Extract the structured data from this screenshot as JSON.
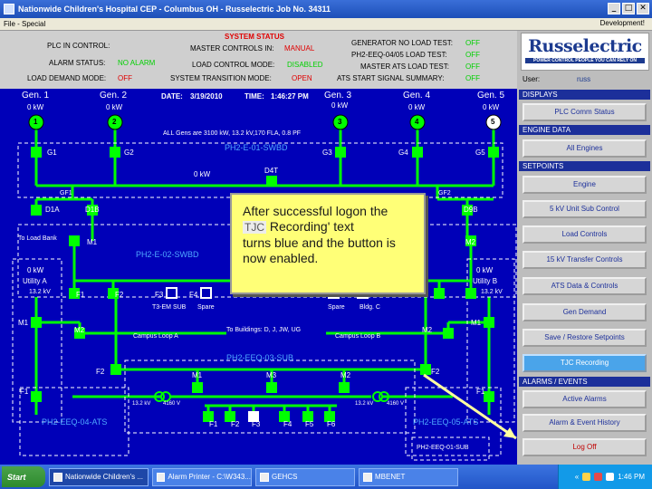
{
  "window": {
    "title": "Nationwide Children's Hospital CEP - Columbus OH - Russelectric Job No. 34311",
    "minimize": "_",
    "maximize": "□",
    "close": "✕"
  },
  "menu": {
    "file_special": "File - Special",
    "development": "Development!"
  },
  "status": {
    "title": "SYSTEM STATUS",
    "plc_label": "PLC IN CONTROL:",
    "alarm_label": "ALARM STATUS:",
    "alarm_value": "NO ALARM",
    "load_demand_label": "LOAD DEMAND MODE:",
    "load_demand_value": "OFF",
    "master_controls_label": "MASTER CONTROLS IN:",
    "master_controls_value": "MANUAL",
    "load_control_label": "LOAD CONTROL MODE:",
    "load_control_value": "DISABLED",
    "transition_label": "SYSTEM TRANSITION MODE:",
    "transition_value": "OPEN",
    "gen_no_load_label": "GENERATOR NO LOAD TEST:",
    "gen_no_load_value": "OFF",
    "ph2_load_label": "PH2-EEQ-04/05 LOAD TEST:",
    "ph2_load_value": "OFF",
    "master_ats_label": "MASTER ATS LOAD TEST:",
    "master_ats_value": "OFF",
    "ats_summary_label": "ATS START SIGNAL SUMMARY:",
    "ats_summary_value": "OFF"
  },
  "diagram": {
    "gens": [
      {
        "name": "Gen. 1",
        "kw": "0 kW",
        "num": "1"
      },
      {
        "name": "Gen. 2",
        "kw": "0 kW",
        "num": "2"
      },
      {
        "name": "Gen. 3",
        "kw": "0 kW",
        "num": "3"
      },
      {
        "name": "Gen. 4",
        "kw": "0 kW",
        "num": "4"
      },
      {
        "name": "Gen. 5",
        "kw": "0 kW",
        "num": "5"
      }
    ],
    "date_label": "DATE:",
    "date_value": "3/19/2010",
    "time_label": "TIME:",
    "time_value": "1:46:27 PM",
    "rating_note": "ALL Gens are 3100 kW, 13.2 kV,170 FLA, 0.8 PF",
    "swbd1": "PH2-E-01-SWBD",
    "swbd1_kw": "0 kW",
    "g1": "G1",
    "g2": "G2",
    "g3": "G3",
    "g4": "G4",
    "g5": "G5",
    "d4t": "D4T",
    "gf1": "GF1",
    "gf2": "GF2",
    "d1a": "D1A",
    "d1b": "D1B",
    "d9b": "D9B",
    "to_load_bank": "To Load Bank",
    "m1_left": "M1",
    "m2_right": "M2",
    "swbd2": "PH2-E-02-SWBD",
    "utility_a_kw": "0 kW",
    "utility_a": "Utility A",
    "utility_a_kv": "13.2 kV",
    "utility_b_kw": "0 kW",
    "utility_b": "Utility B",
    "utility_b_kv": "13.2 kV",
    "f1": "F1",
    "f2": "F2",
    "f3": "F3",
    "f4": "F4",
    "t3_em_sub": "T3-EM SUB",
    "spare": "Spare",
    "spare2": "Spare",
    "bldg_c": "Bldg. C",
    "m1": "M1",
    "m2": "M2",
    "campus_loop_a": "Campus Loop A",
    "campus_loop_b": "Campus Loop B",
    "to_buildings": "To Buildings: D, J, JW, UG",
    "m1_far_right": "M1",
    "m2_far_right": "M2",
    "sub3": "PH2-EEQ-03-SUB",
    "f2_left": "F2",
    "f2_right": "F2",
    "sub_m1": "M1",
    "sub_m3": "M3",
    "sub_m2": "M2",
    "f1_left": "F1",
    "f1_right": "F1",
    "kv_left": "13.2 kV",
    "v_left": "4160 V",
    "kv_right": "13.2 kV",
    "v_right": "4160 V",
    "ats4": "PH2-EEQ-04-ATS",
    "ats5": "PH2-EEQ-05-ATS",
    "sub01": "PH2-EEQ-01-SUB",
    "feeders": [
      "F1",
      "F2",
      "F3",
      "F4",
      "F5",
      "F6"
    ]
  },
  "callout": {
    "line1": "After successful logon the",
    "tjc": "TJC",
    "line2": "Recording' text",
    "line3": "turns blue and the button is",
    "line4": "now enabled."
  },
  "panel": {
    "logo_name": "Russelectric",
    "logo_tag": "POWER CONTROL PEOPLE YOU CAN RELY ON",
    "user_label": "User:",
    "user_name": "russ",
    "sec_displays": "DISPLAYS",
    "plc_comm": "PLC Comm Status",
    "sec_engine": "ENGINE DATA",
    "all_engines": "All Engines",
    "sec_setpoints": "SETPOINTS",
    "engine": "Engine",
    "unit_sub": "5 kV Unit Sub Control",
    "load_controls": "Load Controls",
    "transfer_controls": "15 kV Transfer Controls",
    "ats_data": "ATS Data & Controls",
    "gen_demand": "Gen Demand",
    "save_restore": "Save / Restore Setpoints",
    "tjc_recording": "TJC Recording",
    "sec_alarms": "ALARMS / EVENTS",
    "active_alarms": "Active Alarms",
    "alarm_history": "Alarm & Event History",
    "log_off": "Log Off"
  },
  "taskbar": {
    "start": "Start",
    "tasks": [
      "Nationwide Children's ...",
      "Alarm Printer - C:\\W343...",
      "GEHCS",
      "MBENET"
    ],
    "clock": "1:46 PM",
    "chevron": "«"
  },
  "colors": {
    "bus_green": "#00ff00",
    "diagram_blue": "#0000b8",
    "status_red": "#e00000",
    "panel_section": "#1c2f9a",
    "highlight_blue": "#4aa4ea"
  }
}
